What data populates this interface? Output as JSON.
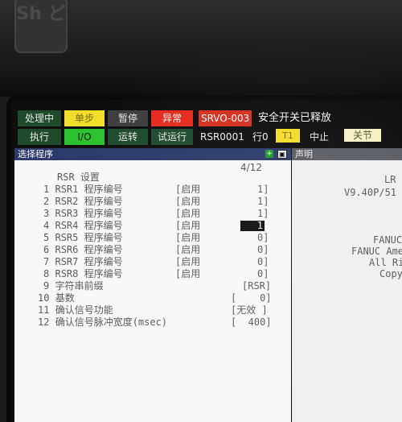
{
  "bezel": {
    "key_text": "Sh\nど"
  },
  "status": {
    "processing": "处理中",
    "single_step": "单步",
    "pause": "暂停",
    "abnormal": "异常",
    "execute": "执行",
    "io": "I/O",
    "running": "运转",
    "trial_run": "试运行"
  },
  "alarm": {
    "code": "SRVO-003",
    "message": "安全开关已释放"
  },
  "program_bar": {
    "program": "RSR0001",
    "line": "行0",
    "mode": "T1",
    "state": "中止",
    "joint": "关节"
  },
  "left_panel": {
    "title": "选择程序",
    "page": "4/12",
    "section": "RSR 设置",
    "rows": [
      {
        "num": "1",
        "label": "RSR1 程序编号",
        "status": "[启用",
        "value": "1]"
      },
      {
        "num": "2",
        "label": "RSR2 程序编号",
        "status": "[启用",
        "value": "1]"
      },
      {
        "num": "3",
        "label": "RSR3 程序编号",
        "status": "[启用",
        "value": "1]"
      },
      {
        "num": "4",
        "label": "RSR4 程序编号",
        "status": "[启用",
        "value": "1"
      },
      {
        "num": "5",
        "label": "RSR5 程序编号",
        "status": "[启用",
        "value": "0]"
      },
      {
        "num": "6",
        "label": "RSR6 程序编号",
        "status": "[启用",
        "value": "0]"
      },
      {
        "num": "7",
        "label": "RSR7 程序编号",
        "status": "[启用",
        "value": "0]"
      },
      {
        "num": "8",
        "label": "RSR8 程序编号",
        "status": "[启用",
        "value": "0]"
      },
      {
        "num": "9",
        "label": "字符串前缀",
        "status": "",
        "value": "[RSR]"
      },
      {
        "num": "10",
        "label": "基数",
        "status": "",
        "value": "[    0]"
      },
      {
        "num": "11",
        "label": "确认信号功能",
        "status": "",
        "value": "[无效 ]"
      },
      {
        "num": "12",
        "label": "确认信号脉冲宽度(msec)",
        "status": "",
        "value": "[  400]"
      }
    ]
  },
  "right_panel": {
    "title": "声明",
    "lines": [
      "LR",
      "V9.40P/51",
      "FANUC",
      "FANUC Ame",
      "All Ri",
      "Copy"
    ]
  }
}
